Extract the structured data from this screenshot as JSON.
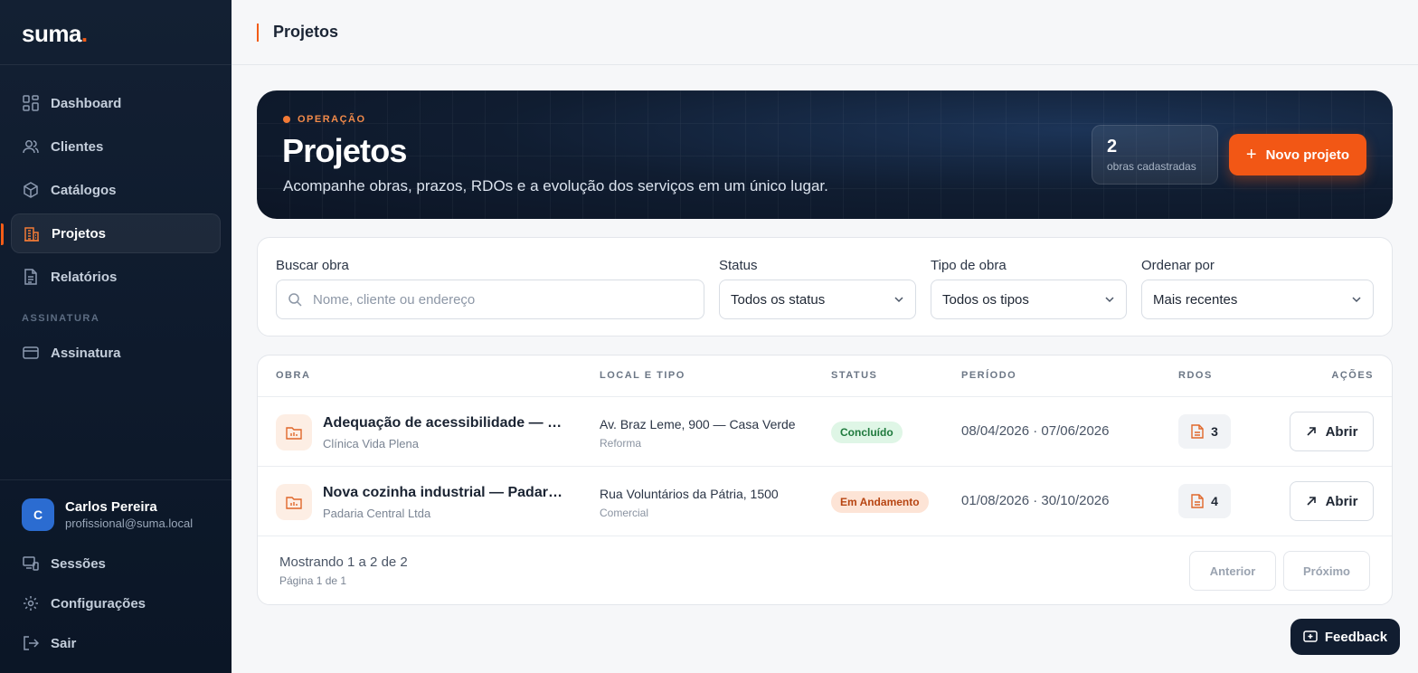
{
  "brand": {
    "name": "suma",
    "dot": "."
  },
  "sidebar": {
    "items": [
      {
        "label": "Dashboard",
        "icon": "dashboard-icon"
      },
      {
        "label": "Clientes",
        "icon": "users-icon"
      },
      {
        "label": "Catálogos",
        "icon": "box-icon"
      },
      {
        "label": "Projetos",
        "icon": "building-icon",
        "active": true
      },
      {
        "label": "Relatórios",
        "icon": "report-icon"
      }
    ],
    "section_label": "ASSINATURA",
    "section_items": [
      {
        "label": "Assinatura",
        "icon": "card-icon"
      }
    ],
    "user": {
      "initial": "C",
      "name": "Carlos Pereira",
      "email": "profissional@suma.local"
    },
    "bottom_links": [
      {
        "label": "Sessões",
        "icon": "sessions-icon"
      },
      {
        "label": "Configurações",
        "icon": "gear-icon"
      },
      {
        "label": "Sair",
        "icon": "logout-icon"
      }
    ]
  },
  "topbar": {
    "title": "Projetos"
  },
  "hero": {
    "eyebrow": "OPERAÇÃO",
    "title": "Projetos",
    "subtitle": "Acompanhe obras, prazos, RDOs e a evolução dos serviços em um único lugar.",
    "count": "2",
    "count_label": "obras cadastradas",
    "new_button": "Novo projeto"
  },
  "filters": {
    "search_label": "Buscar obra",
    "search_placeholder": "Nome, cliente ou endereço",
    "status_label": "Status",
    "status_value": "Todos os status",
    "type_label": "Tipo de obra",
    "type_value": "Todos os tipos",
    "order_label": "Ordenar por",
    "order_value": "Mais recentes"
  },
  "table": {
    "headers": {
      "obra": "OBRA",
      "local": "LOCAL E TIPO",
      "status": "STATUS",
      "periodo": "PERÍODO",
      "rdos": "RDOS",
      "acoes": "AÇÕES"
    },
    "rows": [
      {
        "name": "Adequação de acessibilidade — Clínica Vida Plena",
        "client": "Clínica Vida Plena",
        "local": "Av. Braz Leme, 900 — Casa Verde",
        "tipo": "Reforma",
        "status": "Concluído",
        "status_kind": "done",
        "periodo": "08/04/2026 · 07/06/2026",
        "rdos": "3",
        "action": "Abrir"
      },
      {
        "name": "Nova cozinha industrial — Padaria Central",
        "client": "Padaria Central Ltda",
        "local": "Rua Voluntários da Pátria, 1500",
        "tipo": "Comercial",
        "status": "Em Andamento",
        "status_kind": "prog",
        "periodo": "01/08/2026 · 30/10/2026",
        "rdos": "4",
        "action": "Abrir"
      }
    ],
    "footer": {
      "showing": "Mostrando 1 a 2 de 2",
      "page": "Página 1 de 1",
      "prev": "Anterior",
      "next": "Próximo"
    }
  },
  "feedback": "Feedback",
  "colors": {
    "accent": "#f25715",
    "sidebar": "#0e1a2c",
    "done_bg": "#dff6e6",
    "prog_bg": "#fde4d6"
  }
}
